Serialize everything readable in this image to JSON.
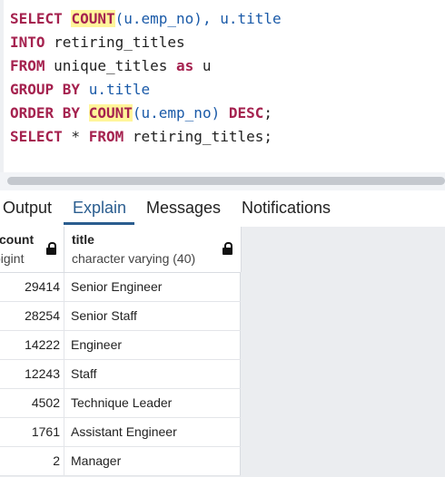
{
  "editor": {
    "lines": [
      [
        {
          "t": "SELECT",
          "c": "kw"
        },
        {
          "t": " ",
          "c": "op"
        },
        {
          "t": "COUNT",
          "c": "fn"
        },
        {
          "t": "(u.emp_no), u.title",
          "c": "id"
        }
      ],
      [
        {
          "t": "INTO",
          "c": "kw"
        },
        {
          "t": " retiring_titles",
          "c": "op"
        }
      ],
      [
        {
          "t": "FROM",
          "c": "kw"
        },
        {
          "t": " unique_titles ",
          "c": "op"
        },
        {
          "t": "as",
          "c": "kw"
        },
        {
          "t": " u",
          "c": "op"
        }
      ],
      [
        {
          "t": "GROUP BY",
          "c": "kw"
        },
        {
          "t": " u.title",
          "c": "id"
        }
      ],
      [
        {
          "t": "ORDER BY",
          "c": "kw"
        },
        {
          "t": " ",
          "c": "op"
        },
        {
          "t": "COUNT",
          "c": "fn"
        },
        {
          "t": "(u.emp_no) ",
          "c": "id"
        },
        {
          "t": "DESC",
          "c": "kw"
        },
        {
          "t": ";",
          "c": "op"
        }
      ],
      [
        {
          "t": "SELECT",
          "c": "kw"
        },
        {
          "t": " * ",
          "c": "op"
        },
        {
          "t": "FROM",
          "c": "kw"
        },
        {
          "t": " retiring_titles;",
          "c": "op"
        }
      ]
    ]
  },
  "tabs": {
    "output": "Output",
    "explain": "Explain",
    "messages": "Messages",
    "notifications": "Notifications"
  },
  "grid": {
    "columns": [
      {
        "name": "count",
        "type": "bigint"
      },
      {
        "name": "title",
        "type": "character varying (40)"
      }
    ],
    "rows": [
      {
        "count": "29414",
        "title": "Senior Engineer"
      },
      {
        "count": "28254",
        "title": "Senior Staff"
      },
      {
        "count": "14222",
        "title": "Engineer"
      },
      {
        "count": "12243",
        "title": "Staff"
      },
      {
        "count": "4502",
        "title": "Technique Leader"
      },
      {
        "count": "1761",
        "title": "Assistant Engineer"
      },
      {
        "count": "2",
        "title": "Manager"
      }
    ]
  },
  "icons": {
    "column_lock": "lock-icon"
  },
  "colors": {
    "keyword": "#a5224f",
    "identifier": "#1a5aa8",
    "function_highlight": "#fff59a",
    "active_tab": "#2a5d8f",
    "grid_background": "#ebedf0"
  }
}
